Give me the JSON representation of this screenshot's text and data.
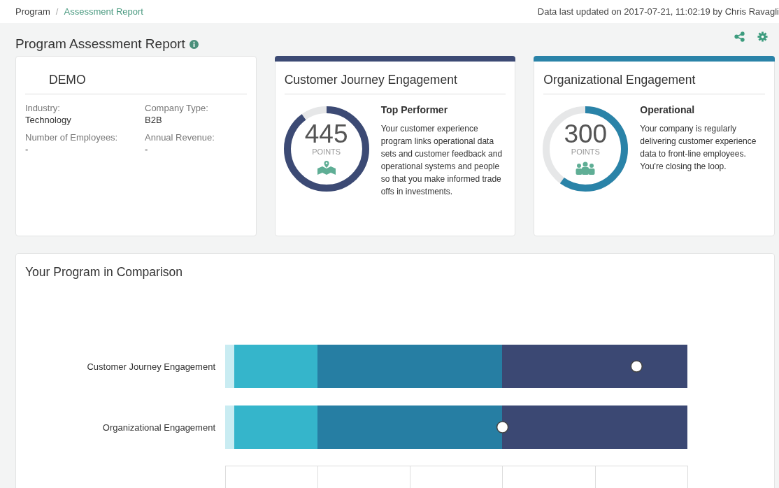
{
  "breadcrumb_separator": "/",
  "breadcrumb": [
    {
      "label": "Program",
      "selected": false
    },
    {
      "label": "Assessment Report",
      "selected": true
    }
  ],
  "updated": "Data last updated on 2017-07-21, 11:02:19 by Chris Ravagli",
  "title": "Program Assessment Report",
  "company": {
    "name": "DEMO",
    "fields": [
      {
        "label": "Industry:",
        "value": "Technology"
      },
      {
        "label": "Company Type:",
        "value": "B2B"
      },
      {
        "label": "Number of Employees:",
        "value": "-"
      },
      {
        "label": "Annual Revenue:",
        "value": "-"
      }
    ]
  },
  "scores": [
    {
      "title": "Customer Journey Engagement",
      "color": "#3c4a74",
      "score": "445",
      "unit": "POINTS",
      "level": 0.9,
      "kind": "map",
      "rating": "Top Performer",
      "description": "Your customer experience program links operational data sets and customer feedback and operational systems and people so that you make informed trade offs in investments."
    },
    {
      "title": "Organizational Engagement",
      "color": "#2a83a8",
      "score": "300",
      "unit": "POINTS",
      "level": 0.6,
      "kind": "people",
      "rating": "Operational",
      "description": "Your company is regularly delivering customer experience data to front-line employees. You're closing the loop."
    }
  ],
  "comparison": {
    "title": "Your Program in Comparison",
    "rows": [
      {
        "label": "Customer Journey Engagement",
        "level": 0.89
      },
      {
        "label": "Organizational Engagement",
        "level": 0.6
      }
    ]
  }
}
